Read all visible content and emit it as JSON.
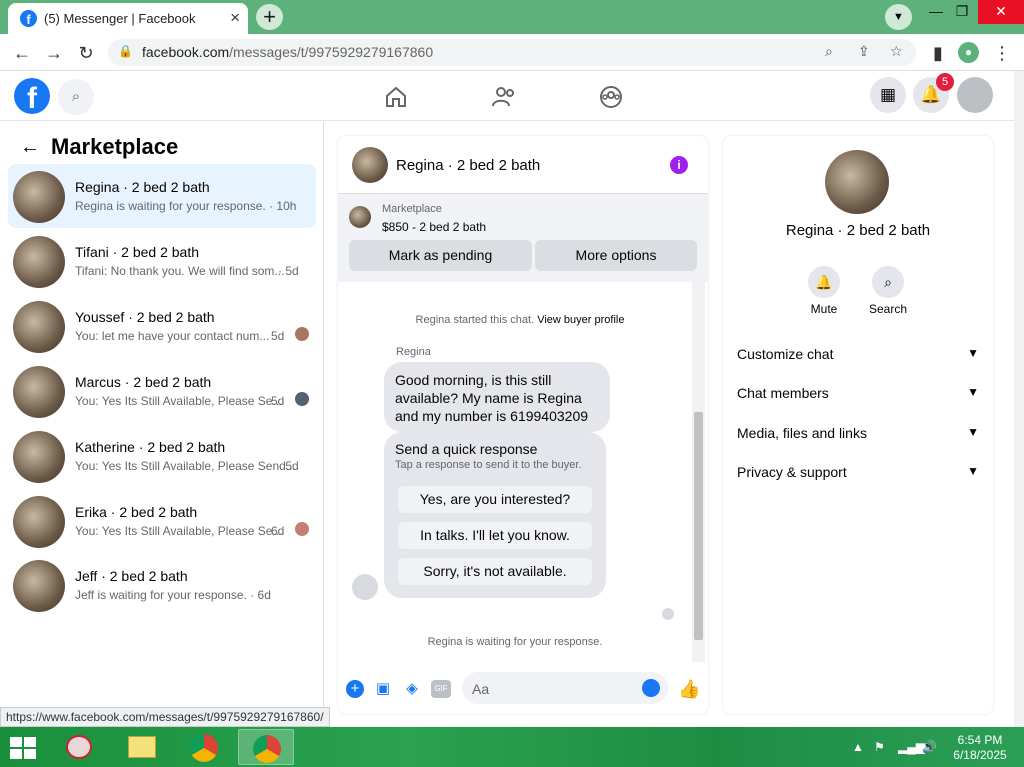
{
  "browser": {
    "tab_title": "(5) Messenger | Facebook",
    "url_host": "facebook.com",
    "url_path": "/messages/t/9975929279167860",
    "status_url": "https://www.facebook.com/messages/t/9975929279167860/"
  },
  "fb": {
    "notification_count": "5"
  },
  "left": {
    "title": "Marketplace",
    "conversations": [
      {
        "name": "Regina · 2 bed 2 bath",
        "snippet": "Regina is waiting for your response. · 10h",
        "time": ""
      },
      {
        "name": "Tifani · 2 bed 2 bath",
        "snippet": "Tifani: No thank you. We will find som...",
        "time": "· 5d"
      },
      {
        "name": "Youssef · 2 bed 2 bath",
        "snippet": "You: let me have your contact num...",
        "time": "5d"
      },
      {
        "name": "Marcus · 2 bed 2 bath",
        "snippet": "You: Yes Its Still Available, Please Se...",
        "time": "5d"
      },
      {
        "name": "Katherine · 2 bed 2 bath",
        "snippet": "You: Yes Its Still Available, Please Send...",
        "time": "· 5d"
      },
      {
        "name": "Erika · 2 bed 2 bath",
        "snippet": "You: Yes Its Still Available, Please Se...",
        "time": "6d"
      },
      {
        "name": "Jeff · 2 bed 2 bath",
        "snippet": "Jeff is waiting for your response. · 6d",
        "time": ""
      }
    ]
  },
  "chat": {
    "header_name": "Regina · 2 bed 2 bath",
    "marketplace_label": "Marketplace",
    "listing": "$850 - 2 bed 2 bath",
    "mark_pending": "Mark as pending",
    "more_options": "More options",
    "system_msg": "Regina started this chat.",
    "view_buyer": "View buyer profile",
    "sender": "Regina",
    "message": "Good morning, is this still available? My name is Regina and my number is 6199403209",
    "quick_title": "Send a quick response",
    "quick_sub": "Tap a response to send it to the buyer.",
    "quick_replies": [
      "Yes, are you interested?",
      "In talks. I'll let you know.",
      "Sorry, it's not available."
    ],
    "waiting": "Regina is waiting for your response.",
    "input_placeholder": "Aa"
  },
  "right": {
    "name": "Regina · 2 bed 2 bath",
    "mute": "Mute",
    "search": "Search",
    "rows": [
      "Customize chat",
      "Chat members",
      "Media, files and links",
      "Privacy & support"
    ]
  },
  "taskbar": {
    "time": "6:54 PM",
    "date": "6/18/2025"
  },
  "colors": {
    "fb_blue": "#1877f2",
    "tab_strip": "#5cb27a",
    "notification_red": "#e41e3f"
  }
}
